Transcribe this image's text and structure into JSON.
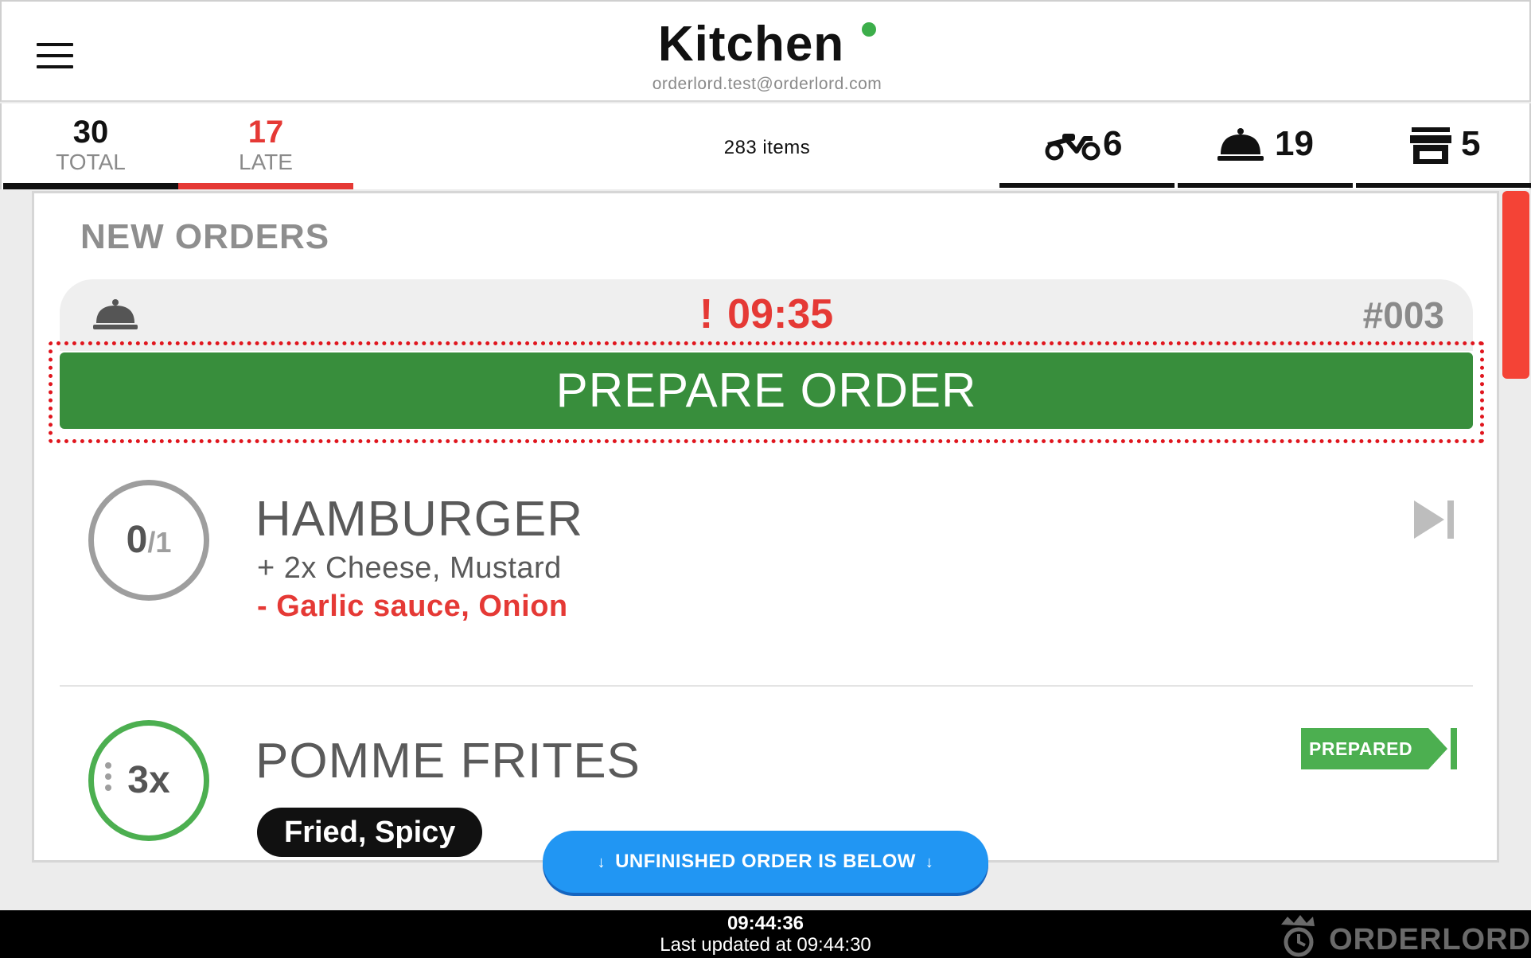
{
  "header": {
    "title": "Kitchen",
    "subtitle": "orderlord.test@orderlord.com",
    "status_color": "#3cae4a"
  },
  "stats": {
    "total": {
      "value": "30",
      "label": "TOTAL"
    },
    "late": {
      "value": "17",
      "label": "LATE"
    },
    "items": "283 items",
    "delivery": {
      "icon": "scooter-icon",
      "count": "6"
    },
    "dine_in": {
      "icon": "cloche-icon",
      "count": "19"
    },
    "pickup": {
      "icon": "store-icon",
      "count": "5"
    }
  },
  "section": {
    "title": "NEW ORDERS"
  },
  "order": {
    "type_icon": "cloche-icon",
    "late_mark": "!",
    "time": "09:35",
    "number": "#003",
    "prepare_label": "PREPARE ORDER"
  },
  "items": [
    {
      "qty_done": "0",
      "qty_sep": "/1",
      "name": "HAMBURGER",
      "add_mods": "+ 2x Cheese, Mustard",
      "remove_mods": "- Garlic sauce, Onion",
      "action_icon": "skip-next-icon"
    },
    {
      "qty": "3x",
      "name": "POMME FRITES",
      "tags": "Fried, Spicy",
      "action_label": "PREPARED"
    }
  ],
  "unfinished": {
    "label": "UNFINISHED ORDER IS BELOW",
    "arrow": "↓"
  },
  "footer": {
    "clock": "09:44:36",
    "updated": "Last updated at 09:44:30",
    "brand": "ORDERLORD"
  },
  "colors": {
    "accent_green": "#388e3c",
    "late_red": "#e53935",
    "info_blue": "#2196f3"
  }
}
